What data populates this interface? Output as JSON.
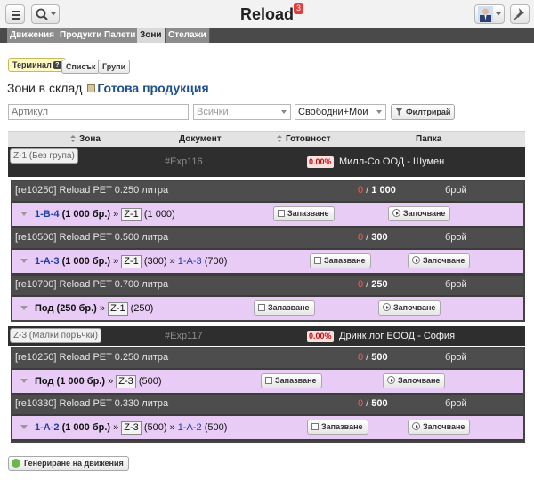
{
  "app": {
    "title": "Reload",
    "notifications": "3"
  },
  "tabs": [
    "Движения",
    "Продукти",
    "Палети",
    "Зони",
    "Стелажи"
  ],
  "active_tab": "Зони",
  "view_buttons": {
    "terminal": "Терминал",
    "terminal_help": "?",
    "list": "Списък",
    "groups": "Групи"
  },
  "page": {
    "title_prefix": "Зони в склад",
    "store": "Готова продукция"
  },
  "filters": {
    "article_placeholder": "Артикул",
    "all_placeholder": "Всички",
    "mode_value": "Свободни+Мои",
    "filter_button": "Филтрирай"
  },
  "table_headers": {
    "zone": "Зона",
    "document": "Документ",
    "readiness": "Готовност",
    "folder": "Папка"
  },
  "groups": [
    {
      "zone": "Z-1 (Без група)",
      "document": "#Exp116",
      "readiness": "0.00%",
      "partner": "Милл-Со ООД - Шумен",
      "items": [
        {
          "name": "[re10250] Reload PET 0.250 литра",
          "done": "0",
          "sep": " / ",
          "total": "1 000",
          "unit": "брой",
          "loc_main": "1-B-4",
          "loc_main_qty": "(1 000 бр.)",
          "arrow": " » ",
          "zone": "Z-1",
          "zone_qty": "(1 000)",
          "extra": "",
          "extra_qty": ""
        },
        {
          "name": "[re10500] Reload PET 0.500 литра",
          "done": "0",
          "sep": " / ",
          "total": "300",
          "unit": "брой",
          "loc_main": "1-A-3",
          "loc_main_qty": "(1 000 бр.)",
          "arrow": " » ",
          "zone": "Z-1",
          "zone_qty": "(300)",
          "extra": "1-A-3",
          "extra_qty": "(700)"
        },
        {
          "name": "[re10700] Reload PET 0.700 литра",
          "done": "0",
          "sep": " / ",
          "total": "250",
          "unit": "брой",
          "loc_main": "Под",
          "loc_main_qty": "(250 бр.)",
          "arrow": " » ",
          "zone": "Z-1",
          "zone_qty": "(250)",
          "extra": "",
          "extra_qty": ""
        }
      ]
    },
    {
      "zone": "Z-3 (Малки поръчки)",
      "document": "#Exp117",
      "readiness": "0.00%",
      "partner": "Дринк лог ЕООД - София",
      "items": [
        {
          "name": "[re10250] Reload PET 0.250 литра",
          "done": "0",
          "sep": " / ",
          "total": "500",
          "unit": "брой",
          "loc_main": "Под",
          "loc_main_qty": "(1 000 бр.)",
          "arrow": " » ",
          "zone": "Z-3",
          "zone_qty": "(500)",
          "extra": "",
          "extra_qty": ""
        },
        {
          "name": "[re10330] Reload PET 0.330 литра",
          "done": "0",
          "sep": " / ",
          "total": "500",
          "unit": "брой",
          "loc_main": "1-A-2",
          "loc_main_qty": "(1 000 бр.)",
          "arrow": " » ",
          "zone": "Z-3",
          "zone_qty": "(500)",
          "extra": "1-A-2",
          "extra_qty": "(500)"
        }
      ]
    }
  ],
  "actions": {
    "reserve": "Запазване",
    "start": "Започване",
    "extra_arrow": " » "
  },
  "generate_button": "Генериране на движения"
}
